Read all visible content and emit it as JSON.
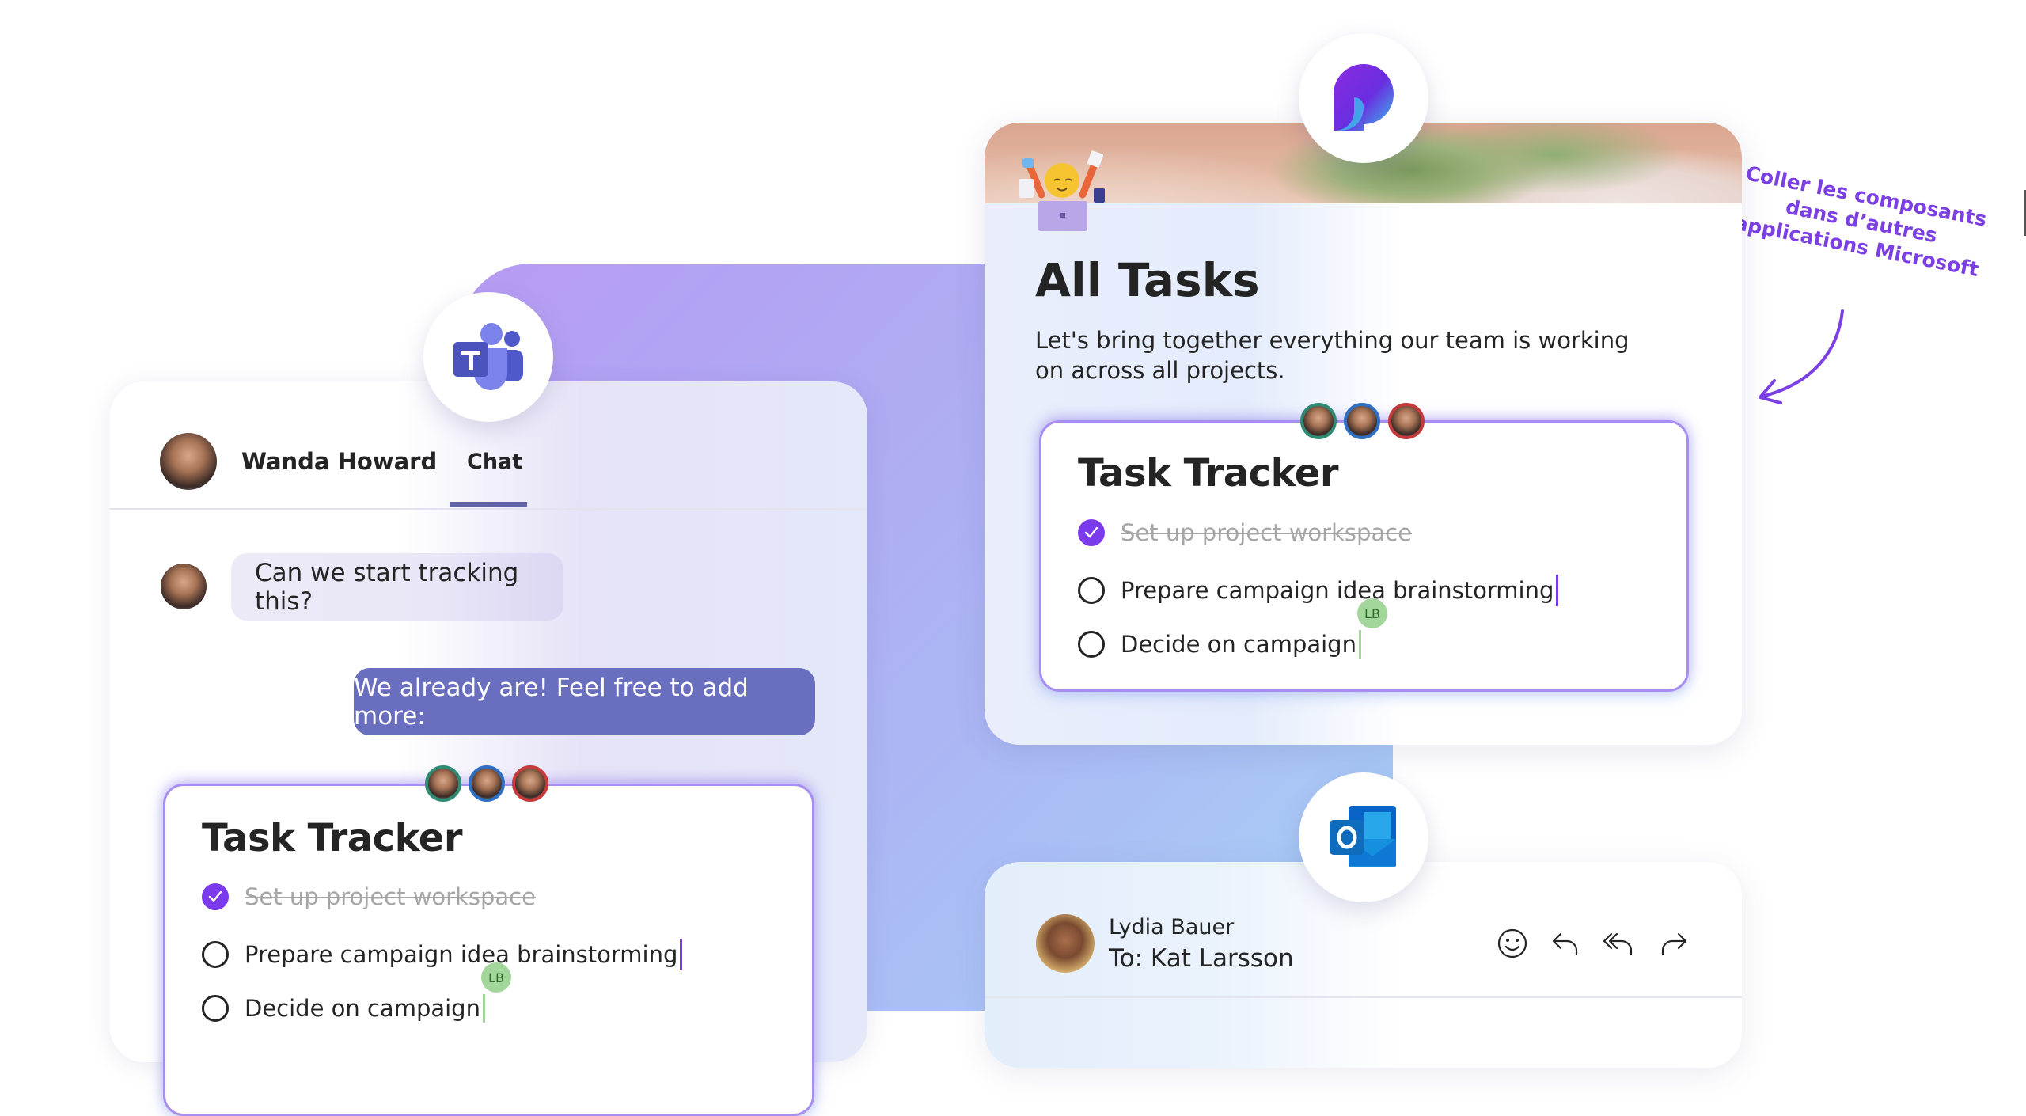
{
  "teams": {
    "app_icon": "microsoft-teams-icon",
    "contact_name": "Wanda Howard",
    "active_tab": "Chat",
    "messages": [
      {
        "from": "Wanda Howard",
        "direction": "incoming",
        "text": "Can we start tracking this?"
      },
      {
        "from": "me",
        "direction": "outgoing",
        "text": "We already are! Feel free to add more:"
      }
    ],
    "task_tracker": {
      "title": "Task Tracker",
      "tasks": [
        {
          "label": "Set up project workspace",
          "done": true
        },
        {
          "label": "Prepare campaign idea brainstorming",
          "done": false
        },
        {
          "label": "Decide on campaign",
          "done": false
        }
      ],
      "collaborator_badge": "LB"
    }
  },
  "loop": {
    "app_icon": "microsoft-loop-icon",
    "page_title": "All Tasks",
    "description": "Let's bring together everything our team is working on across all projects.",
    "task_tracker": {
      "title": "Task Tracker",
      "tasks": [
        {
          "label": "Set up project workspace",
          "done": true
        },
        {
          "label": "Prepare campaign idea brainstorming",
          "done": false
        },
        {
          "label": "Decide on campaign",
          "done": false
        }
      ],
      "collaborator_badge": "LB"
    }
  },
  "outlook": {
    "app_icon": "microsoft-outlook-icon",
    "sender": "Lydia Bauer",
    "recipient_line": "To: Kat Larsson",
    "actions": [
      "emoji-react",
      "reply",
      "reply-all",
      "forward"
    ]
  },
  "annotation": {
    "lines": [
      "Coller les composants",
      "dans d’autres",
      "applications Microsoft"
    ]
  },
  "colors": {
    "accent_purple": "#7c3aed",
    "teams_purple": "#6264a7",
    "outgoing_bubble": "#6a6ebf",
    "annotation": "#7b3fe4",
    "collab_ring_green": "#2e8b74",
    "collab_ring_blue": "#2f6fc4",
    "collab_ring_red": "#c53a3a"
  }
}
